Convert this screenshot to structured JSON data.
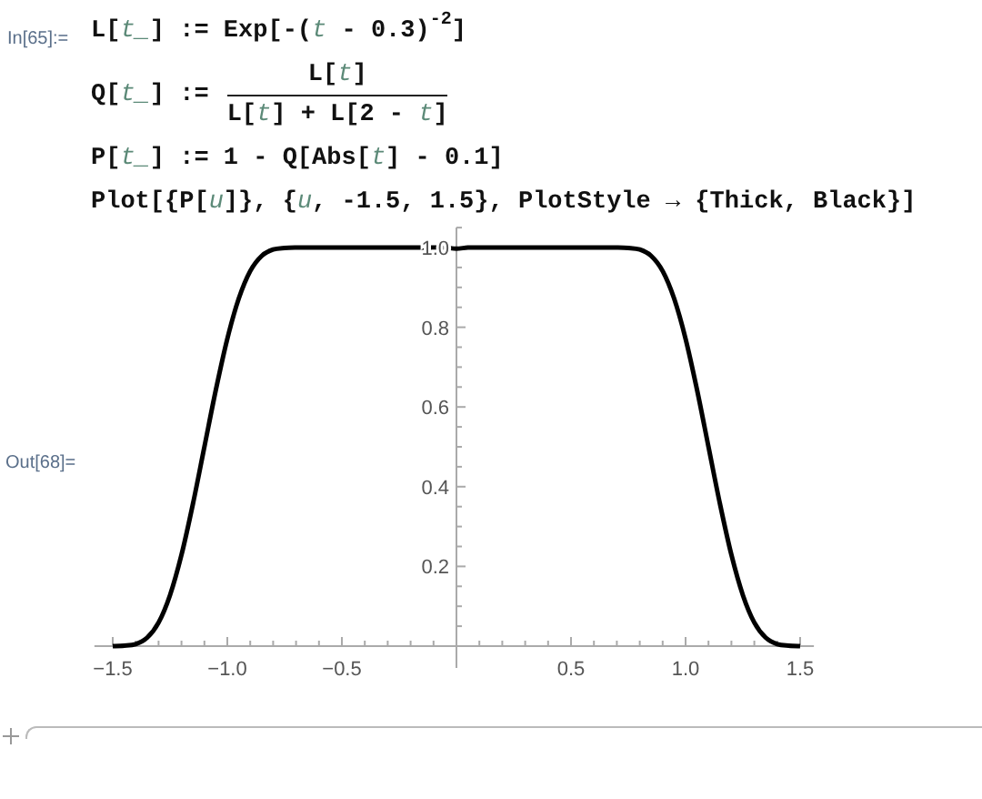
{
  "input_cell": {
    "label": "In[65]:=",
    "lines": [
      {
        "kind": "plain",
        "parts": [
          {
            "kind": "code",
            "text": "L["
          },
          {
            "kind": "var",
            "text": "t_"
          },
          {
            "kind": "code",
            "text": "] := Exp[-("
          },
          {
            "kind": "var",
            "text": "t"
          },
          {
            "kind": "code",
            "text": " - 0.3)"
          },
          {
            "kind": "sup",
            "text": "-2"
          },
          {
            "kind": "code",
            "text": "]"
          }
        ]
      },
      {
        "kind": "fraction",
        "lhs": [
          {
            "kind": "code",
            "text": "Q["
          },
          {
            "kind": "var",
            "text": "t_"
          },
          {
            "kind": "code",
            "text": "] :="
          }
        ],
        "numerator": [
          {
            "kind": "code",
            "text": "L["
          },
          {
            "kind": "var",
            "text": "t"
          },
          {
            "kind": "code",
            "text": "]"
          }
        ],
        "denominator": [
          {
            "kind": "code",
            "text": "L["
          },
          {
            "kind": "var",
            "text": "t"
          },
          {
            "kind": "code",
            "text": "] + L[2 - "
          },
          {
            "kind": "var",
            "text": "t"
          },
          {
            "kind": "code",
            "text": "]"
          }
        ]
      },
      {
        "kind": "plain",
        "parts": [
          {
            "kind": "code",
            "text": "P["
          },
          {
            "kind": "var",
            "text": "t_"
          },
          {
            "kind": "code",
            "text": "] := 1 - Q[Abs["
          },
          {
            "kind": "var",
            "text": "t"
          },
          {
            "kind": "code",
            "text": "] - 0.1]"
          }
        ]
      },
      {
        "kind": "plain",
        "parts": [
          {
            "kind": "code",
            "text": "Plot[{P["
          },
          {
            "kind": "var",
            "text": "u"
          },
          {
            "kind": "code",
            "text": "]}, {"
          },
          {
            "kind": "var",
            "text": "u"
          },
          {
            "kind": "code",
            "text": ", -1.5, 1.5}, PlotStyle → {Thick, Black}]"
          }
        ]
      }
    ]
  },
  "output_cell": {
    "label": "Out[68]=",
    "chart_data": {
      "type": "line",
      "x": [
        -1.5,
        -1.45,
        -1.4,
        -1.35,
        -1.3,
        -1.25,
        -1.2,
        -1.15,
        -1.1,
        -1.05,
        -1.0,
        -0.95,
        -0.9,
        -0.85,
        -0.8,
        -0.75,
        -0.7,
        -0.6,
        -0.4,
        -0.2,
        -0.1,
        -0.05,
        0,
        0.05,
        0.1,
        0.2,
        0.4,
        0.6,
        0.7,
        0.75,
        0.8,
        0.85,
        0.9,
        0.95,
        1.0,
        1.05,
        1.1,
        1.15,
        1.2,
        1.25,
        1.3,
        1.35,
        1.4,
        1.45,
        1.5
      ],
      "series": [
        {
          "color": "#000000",
          "values": [
            0,
            0.001,
            0.005,
            0.021,
            0.059,
            0.128,
            0.229,
            0.357,
            0.5,
            0.643,
            0.771,
            0.872,
            0.941,
            0.979,
            0.995,
            0.999,
            1,
            1,
            1,
            1,
            1,
            1,
            0.997,
            1,
            1,
            1,
            1,
            1,
            1,
            0.999,
            0.995,
            0.979,
            0.941,
            0.872,
            0.771,
            0.643,
            0.5,
            0.357,
            0.229,
            0.128,
            0.059,
            0.021,
            0.005,
            0.001,
            0
          ]
        }
      ],
      "xlim": [
        -1.58,
        1.56
      ],
      "ylim": [
        0,
        1.05
      ],
      "xticks": [
        {
          "value": -1.5,
          "label": "−1.5"
        },
        {
          "value": -1.0,
          "label": "−1.0"
        },
        {
          "value": -0.5,
          "label": "−0.5"
        },
        {
          "value": 0.5,
          "label": "0.5"
        },
        {
          "value": 1.0,
          "label": "1.0"
        },
        {
          "value": 1.5,
          "label": "1.5"
        }
      ],
      "yticks": [
        {
          "value": 0.2,
          "label": "0.2"
        },
        {
          "value": 0.4,
          "label": "0.4"
        },
        {
          "value": 0.6,
          "label": "0.6"
        },
        {
          "value": 0.8,
          "label": "0.8"
        },
        {
          "value": 1.0,
          "label": "1.0"
        }
      ]
    }
  }
}
